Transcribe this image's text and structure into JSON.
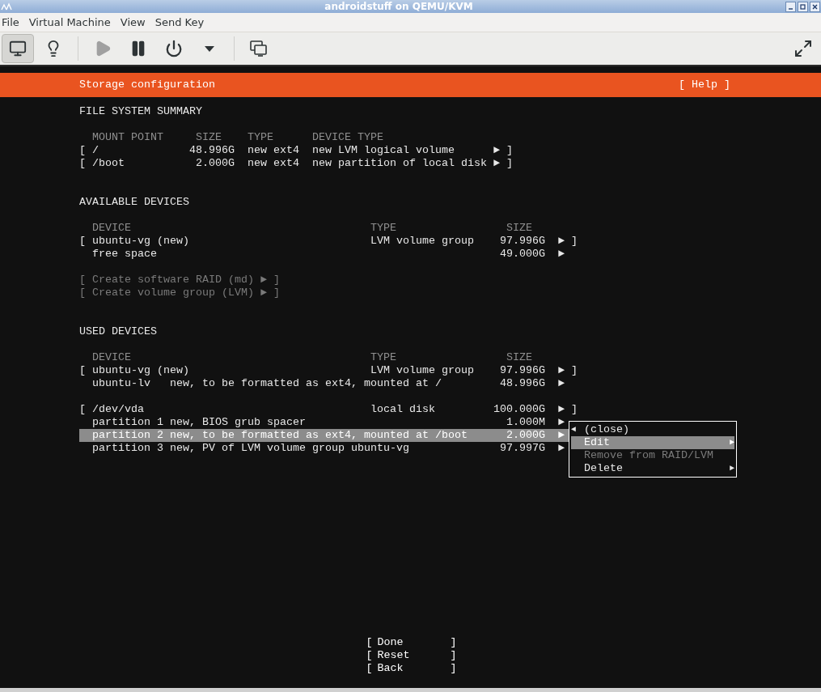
{
  "window": {
    "title": "androidstuff on QEMU/KVM"
  },
  "menu_bar": [
    "File",
    "Virtual Machine",
    "View",
    "Send Key"
  ],
  "toolbar": [
    {
      "kind": "console",
      "selected": true,
      "disabled": false
    },
    {
      "kind": "details",
      "selected": false,
      "disabled": false
    },
    {
      "kind": "run",
      "selected": false,
      "disabled": true
    },
    {
      "kind": "pause",
      "selected": false,
      "disabled": false
    },
    {
      "kind": "shutdown",
      "selected": false,
      "disabled": false
    },
    {
      "kind": "shutdown_menu",
      "selected": false,
      "disabled": false
    },
    {
      "kind": "screenshot",
      "selected": false,
      "disabled": false
    },
    {
      "kind": "fullscreen",
      "selected": false,
      "disabled": false
    }
  ],
  "screen": {
    "header": {
      "title": "Storage configuration",
      "help": "[ Help ]"
    },
    "file_system_summary": {
      "heading": "FILE SYSTEM SUMMARY",
      "columns": [
        "MOUNT POINT",
        "SIZE",
        "TYPE",
        "DEVICE TYPE"
      ],
      "rows": [
        {
          "open": "[",
          "mount_point": "/",
          "size": "48.996G",
          "type": "new ext4",
          "device_type": "new LVM logical volume",
          "arrow": "►",
          "close": "]"
        },
        {
          "open": "[",
          "mount_point": "/boot",
          "size": "2.000G",
          "type": "new ext4",
          "device_type": "new partition of local disk",
          "arrow": "►",
          "close": "]"
        }
      ]
    },
    "available_devices": {
      "heading": "AVAILABLE DEVICES",
      "columns": [
        "DEVICE",
        "TYPE",
        "SIZE"
      ],
      "groups": [
        [
          {
            "open": "[",
            "device": "ubuntu-vg (new)",
            "type": "LVM volume group",
            "size": "97.996G",
            "arrow": "►",
            "close": "]",
            "selected": false
          },
          {
            "device": "free space",
            "size": "49.000G",
            "arrow": "►",
            "selected": false
          }
        ]
      ],
      "actions": [
        {
          "open": "[",
          "label": "Create software RAID (md)",
          "arrow": "►",
          "close": "]",
          "disabled": true
        },
        {
          "open": "[",
          "label": "Create volume group (LVM)",
          "arrow": "►",
          "close": "]",
          "disabled": true
        }
      ]
    },
    "used_devices": {
      "heading": "USED DEVICES",
      "columns": [
        "DEVICE",
        "TYPE",
        "SIZE"
      ],
      "groups": [
        [
          {
            "open": "[",
            "device": "ubuntu-vg (new)",
            "type": "LVM volume group",
            "size": "97.996G",
            "arrow": "►",
            "close": "]",
            "selected": false
          },
          {
            "device": "ubuntu-lv",
            "description": "new, to be formatted as ext4, mounted at /",
            "size": "48.996G",
            "arrow": "►",
            "selected": false
          }
        ],
        [
          {
            "open": "[",
            "device": "/dev/vda",
            "type": "local disk",
            "size": "100.000G",
            "arrow": "►",
            "close": "]",
            "selected": false
          },
          {
            "device": "partition 1",
            "description": "new, BIOS grub spacer",
            "size": "1.000M",
            "arrow": "►",
            "selected": false
          },
          {
            "device": "partition 2",
            "description": "new, to be formatted as ext4, mounted at /boot",
            "size": "2.000G",
            "arrow": "►",
            "selected": true
          },
          {
            "device": "partition 3",
            "description": "new, PV of LVM volume group ubuntu-vg",
            "size": "97.997G",
            "arrow": "►",
            "selected": false
          }
        ]
      ]
    },
    "context_menu": [
      {
        "lead": "◄",
        "label": "(close)",
        "selected": false,
        "disabled": false
      },
      {
        "label": "Edit",
        "arrow": "►",
        "selected": true,
        "disabled": false
      },
      {
        "label": "Remove from RAID/LVM",
        "selected": false,
        "disabled": true
      },
      {
        "label": "Delete",
        "arrow": "►",
        "selected": false,
        "disabled": false
      }
    ],
    "buttons": [
      {
        "open": "[",
        "label": "Done",
        "close": "]"
      },
      {
        "open": "[",
        "label": "Reset",
        "close": "]"
      },
      {
        "open": "[",
        "label": "Back",
        "close": "]"
      }
    ]
  }
}
